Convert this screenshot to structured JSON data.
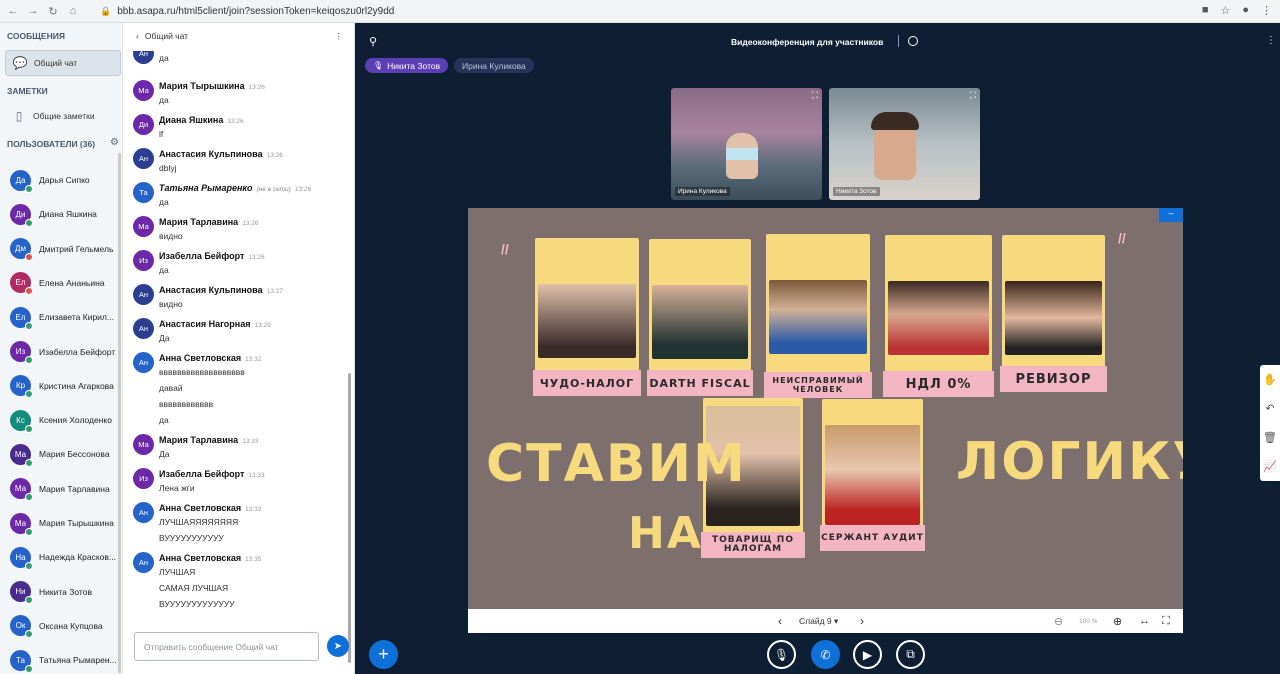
{
  "browser": {
    "url": "bbb.asapa.ru/html5client/join?sessionToken=keiqoszu0rl2y9dd"
  },
  "left": {
    "messages_header": "СООБЩЕНИЯ",
    "public_chat": "Общий чат",
    "notes_header": "ЗАМЕТКИ",
    "shared_notes": "Общие заметки",
    "users_header": "ПОЛЬЗОВАТЕЛИ (36)",
    "users": [
      {
        "initials": "Да",
        "name": "Дарья Сипко",
        "color": "#2563c9",
        "status": "green"
      },
      {
        "initials": "Ди",
        "name": "Диана Яшкина",
        "color": "#6d28a8",
        "status": "green"
      },
      {
        "initials": "Дм",
        "name": "Дмитрий Гельмель",
        "color": "#2563c9",
        "status": "red"
      },
      {
        "initials": "Ел",
        "name": "Елена Ананьина",
        "color": "#b02a63",
        "status": "red"
      },
      {
        "initials": "Ел",
        "name": "Елизавета Кирил...",
        "color": "#2563c9",
        "status": "green"
      },
      {
        "initials": "Из",
        "name": "Изабелла Бейфорт",
        "color": "#6d28a8",
        "status": "green"
      },
      {
        "initials": "Кр",
        "name": "Кристина Агаркова",
        "color": "#2563c9",
        "status": "green"
      },
      {
        "initials": "Кс",
        "name": "Ксения Холоденко",
        "color": "#128c7e",
        "status": "green"
      },
      {
        "initials": "Ма",
        "name": "Мария Бессонова",
        "color": "#4a2a8a",
        "status": "green"
      },
      {
        "initials": "Ма",
        "name": "Мария Тарлавина",
        "color": "#6d28a8",
        "status": "green"
      },
      {
        "initials": "Ма",
        "name": "Мария Тырышкина",
        "color": "#6d28a8",
        "status": "green"
      },
      {
        "initials": "На",
        "name": "Надежда Красков...",
        "color": "#2563c9",
        "status": "green"
      },
      {
        "initials": "Ни",
        "name": "Никита Зотов",
        "color": "#4a2a8a",
        "status": "green"
      },
      {
        "initials": "Ок",
        "name": "Оксана Купцова",
        "color": "#2563c9",
        "status": "green"
      },
      {
        "initials": "Та",
        "name": "Татьяна Рымарен...",
        "color": "#2563c9",
        "status": "green"
      }
    ]
  },
  "chat": {
    "title": "Общий чат",
    "top_fragment": {
      "initials": "Ан",
      "text": "да"
    },
    "messages": [
      {
        "initials": "Ма",
        "color": "#6d28a8",
        "name": "Мария Тырышкина",
        "time": "13:26",
        "lines": [
          "да"
        ]
      },
      {
        "initials": "Ди",
        "color": "#6d28a8",
        "name": "Диана Яшкина",
        "time": "13:26",
        "lines": [
          "lf"
        ]
      },
      {
        "initials": "Ан",
        "color": "#2a3f8f",
        "name": "Анастасия Кульпинова",
        "time": "13:26",
        "lines": [
          "dblyj"
        ]
      },
      {
        "initials": "Та",
        "color": "#2563c9",
        "name": "Татьяна Рымаренко",
        "offline": "(не в сети)",
        "time": "13:26",
        "lines": [
          "да"
        ]
      },
      {
        "initials": "Ма",
        "color": "#6d28a8",
        "name": "Мария Тарлавина",
        "time": "13:26",
        "lines": [
          "видно"
        ]
      },
      {
        "initials": "Из",
        "color": "#6d28a8",
        "name": "Изабелла Бейфорт",
        "time": "13:26",
        "lines": [
          "да"
        ]
      },
      {
        "initials": "Ан",
        "color": "#2a3f8f",
        "name": "Анастасия Кульпинова",
        "time": "13:27",
        "lines": [
          "видно"
        ]
      },
      {
        "initials": "Ан",
        "color": "#2a3f8f",
        "name": "Анастасия Нагорная",
        "time": "13:29",
        "lines": [
          "Да"
        ]
      },
      {
        "initials": "Ан",
        "color": "#2563c9",
        "name": "Анна Светловская",
        "time": "13:32",
        "lines": [
          "ввввввввввввввввввв",
          "давай",
          "вввввввввввв",
          "да"
        ]
      },
      {
        "initials": "Ма",
        "color": "#6d28a8",
        "name": "Мария Тарлавина",
        "time": "13:33",
        "lines": [
          "Да"
        ]
      },
      {
        "initials": "Из",
        "color": "#6d28a8",
        "name": "Изабелла Бейфорт",
        "time": "13:33",
        "lines": [
          "Лена жги"
        ]
      },
      {
        "initials": "Ан",
        "color": "#2563c9",
        "name": "Анна Светловская",
        "time": "13:33",
        "lines": [
          "ЛУЧШАЯЯЯЯЯЯЯЯ",
          "ВУУУУУУУУУУУ"
        ]
      },
      {
        "initials": "Ан",
        "color": "#2563c9",
        "name": "Анна Светловская",
        "time": "13:35",
        "lines": [
          "ЛУЧШАЯ",
          "САМАЯ ЛУЧШАЯ",
          "ВУУУУУУУУУУУУУ"
        ]
      }
    ],
    "input_placeholder": "Отправить сообщение Общий чат"
  },
  "main": {
    "title": "Видеоконференция для участников",
    "talkers": [
      {
        "name": "Никита Зотов",
        "active": true
      },
      {
        "name": "Ирина Куликова",
        "active": false
      }
    ],
    "videos": [
      {
        "name": "Ирина Куликова"
      },
      {
        "name": "Никита Зотов"
      }
    ],
    "slide": {
      "cards": [
        {
          "caption": "ЧУДО-НАЛОГ"
        },
        {
          "caption": "DARTH FISCAL"
        },
        {
          "caption": "НЕИСПРАВИМЫЙ ЧЕЛОВЕК"
        },
        {
          "caption": "НДЛ 0%"
        },
        {
          "caption": "РЕВИЗОР"
        },
        {
          "caption": "ТОВАРИЩ ПО НАЛОГАМ"
        },
        {
          "caption": "СЕРЖАНТ АУДИТ"
        }
      ],
      "text_left_1": "СТАВИМ",
      "text_left_2": "НА",
      "text_right": "ЛОГИКУ"
    },
    "slide_label": "Слайд 9",
    "zoom": "100 %"
  }
}
